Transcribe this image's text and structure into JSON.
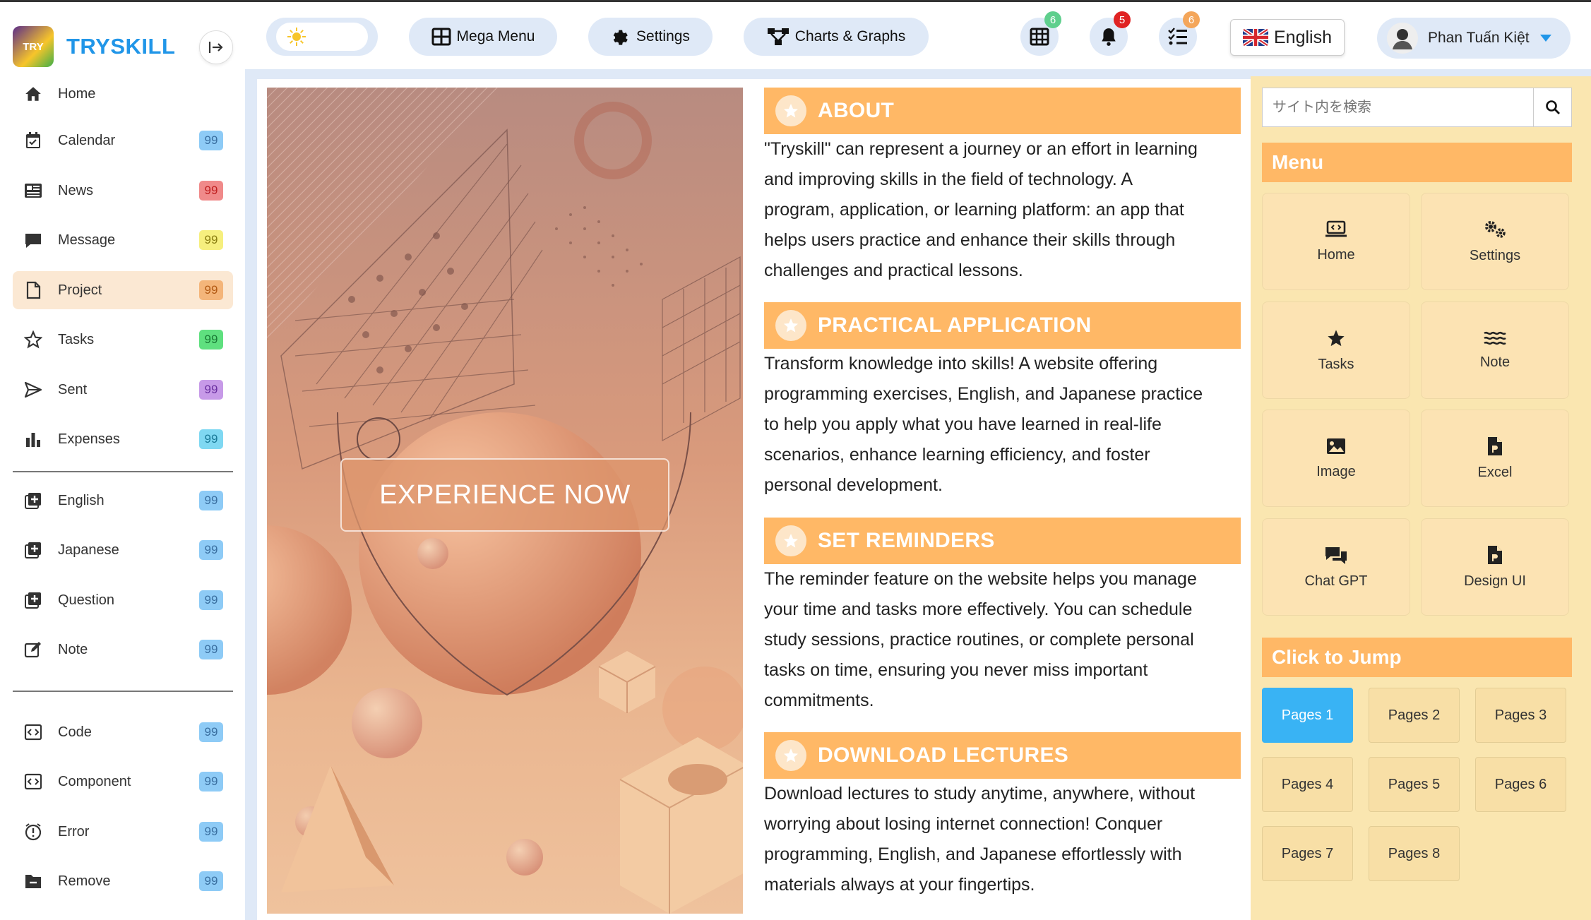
{
  "brand": {
    "logo_text": "TRY",
    "name": "TRYSKILL"
  },
  "sidebar": {
    "items": [
      {
        "label": "Home"
      },
      {
        "label": "Calendar",
        "badge": "99",
        "badge_color": "#8ecbf6"
      },
      {
        "label": "News",
        "badge": "99",
        "badge_color": "#f08a8a"
      },
      {
        "label": "Message",
        "badge": "99",
        "badge_color": "#f6ef7e"
      },
      {
        "label": "Project",
        "badge": "99",
        "badge_color": "#f4b57a"
      },
      {
        "label": "Tasks",
        "badge": "99",
        "badge_color": "#5fe07f"
      },
      {
        "label": "Sent",
        "badge": "99",
        "badge_color": "#c79ae8"
      },
      {
        "label": "Expenses",
        "badge": "99",
        "badge_color": "#7fd8f2"
      },
      {
        "label": "English",
        "badge": "99",
        "badge_color": "#8ecbf6"
      },
      {
        "label": "Japanese",
        "badge": "99",
        "badge_color": "#8ecbf6"
      },
      {
        "label": "Question",
        "badge": "99",
        "badge_color": "#8ecbf6"
      },
      {
        "label": "Note",
        "badge": "99",
        "badge_color": "#8ecbf6"
      },
      {
        "label": "Code",
        "badge": "99",
        "badge_color": "#8ecbf6"
      },
      {
        "label": "Component",
        "badge": "99",
        "badge_color": "#8ecbf6"
      },
      {
        "label": "Error",
        "badge": "99",
        "badge_color": "#8ecbf6"
      },
      {
        "label": "Remove",
        "badge": "99",
        "badge_color": "#8ecbf6"
      }
    ],
    "active_item": "Project"
  },
  "topbar": {
    "mega_menu": "Mega Menu",
    "settings": "Settings",
    "charts": "Charts & Graphs",
    "grid_count": "6",
    "notification_count": "5",
    "tasks_count": "6",
    "language": "English",
    "user_name": "Phan Tuấn Kiệt"
  },
  "hero": {
    "button": "EXPERIENCE NOW"
  },
  "sections": [
    {
      "title": "ABOUT",
      "lines": [
        "\"Tryskill\" can represent a journey or an effort in learning",
        "and improving skills in the field of technology. A",
        "program, application, or learning platform: an app that",
        "helps users practice and enhance their skills through",
        "challenges and practical lessons."
      ]
    },
    {
      "title": "PRACTICAL APPLICATION",
      "lines": [
        "Transform knowledge into skills! A website offering",
        "programming exercises, English, and Japanese practice",
        "to help you apply what you have learned in real-life",
        "scenarios, enhance learning efficiency, and foster",
        "personal development."
      ]
    },
    {
      "title": "SET REMINDERS",
      "lines": [
        "The reminder feature on the website helps you manage",
        "your time and tasks more effectively. You can schedule",
        "study sessions, practice routines, or complete personal",
        "tasks on time, ensuring you never miss important",
        "commitments."
      ]
    },
    {
      "title": "DOWNLOAD LECTURES",
      "lines": [
        "Download lectures to study anytime, anywhere, without",
        "worrying about losing internet connection! Conquer",
        "programming, English, and Japanese effortlessly with",
        "materials always at your fingertips."
      ]
    }
  ],
  "right_panel": {
    "search_placeholder": "サイト内を検索",
    "menu_title": "Menu",
    "tiles": [
      {
        "label": "Home",
        "icon": "laptop-code-icon"
      },
      {
        "label": "Settings",
        "icon": "gears-icon"
      },
      {
        "label": "Tasks",
        "icon": "star-icon"
      },
      {
        "label": "Note",
        "icon": "water-icon"
      },
      {
        "label": "Image",
        "icon": "image-icon"
      },
      {
        "label": "Excel",
        "icon": "file-icon"
      },
      {
        "label": "Chat GPT",
        "icon": "comments-icon"
      },
      {
        "label": "Design UI",
        "icon": "file-icon"
      }
    ],
    "jump_title": "Click to Jump",
    "pages": [
      "Pages 1",
      "Pages 2",
      "Pages 3",
      "Pages 4",
      "Pages 5",
      "Pages 6",
      "Pages 7",
      "Pages 8"
    ],
    "active_page": "Pages 1"
  },
  "colors": {
    "accent": "#ffb866",
    "brand": "#2196e8",
    "active_page": "#39b3f4",
    "panel_bg": "#fae6b0"
  }
}
